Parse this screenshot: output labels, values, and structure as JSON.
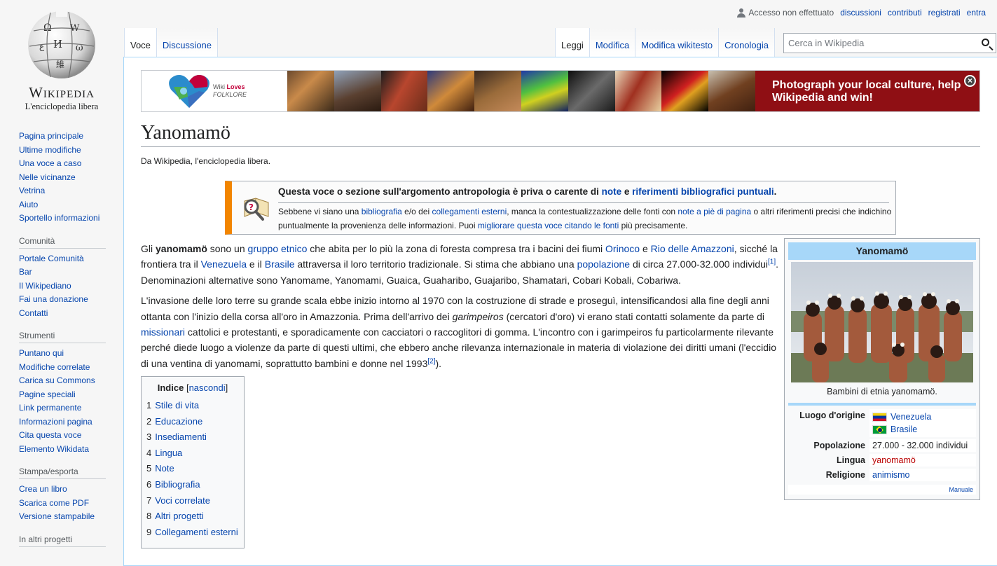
{
  "personal": {
    "status": "Accesso non effettuato",
    "links": [
      "discussioni",
      "contributi",
      "registrati",
      "entra"
    ]
  },
  "logo": {
    "wordmark": "Wikipedia",
    "tagline": "L'enciclopedia libera"
  },
  "sidebar": {
    "nav": [
      "Pagina principale",
      "Ultime modifiche",
      "Una voce a caso",
      "Nelle vicinanze",
      "Vetrina",
      "Aiuto",
      "Sportello informazioni"
    ],
    "comunita": {
      "heading": "Comunità",
      "items": [
        "Portale Comunità",
        "Bar",
        "Il Wikipediano",
        "Fai una donazione",
        "Contatti"
      ]
    },
    "strumenti": {
      "heading": "Strumenti",
      "items": [
        "Puntano qui",
        "Modifiche correlate",
        "Carica su Commons",
        "Pagine speciali",
        "Link permanente",
        "Informazioni pagina",
        "Cita questa voce",
        "Elemento Wikidata"
      ]
    },
    "stampa": {
      "heading": "Stampa/esporta",
      "items": [
        "Crea un libro",
        "Scarica come PDF",
        "Versione stampabile"
      ]
    },
    "altri": {
      "heading": "In altri progetti"
    }
  },
  "tabs": {
    "left": [
      "Voce",
      "Discussione"
    ],
    "right": [
      "Leggi",
      "Modifica",
      "Modifica wikitesto",
      "Cronologia"
    ]
  },
  "search": {
    "placeholder": "Cerca in Wikipedia"
  },
  "banner": {
    "logo_line1": "Wiki",
    "logo_line1b": "Loves",
    "logo_line2": "FOLKLORE",
    "cta": "Photograph your local culture, help Wikipedia and win!",
    "close": "×"
  },
  "article": {
    "title": "Yanomamö",
    "site_sub": "Da Wikipedia, l'enciclopedia libera.",
    "ambox": {
      "title_a": "Questa voce o sezione sull'argomento antropologia è priva o carente di ",
      "title_link1": "note",
      "title_b": " e ",
      "title_link2": "riferimenti bibliografici puntuali",
      "title_c": ".",
      "t_a": "Sebbene vi siano una ",
      "t_link1": "bibliografia",
      "t_b": " e/o dei ",
      "t_link2": "collegamenti esterni",
      "t_c": ", manca la contestualizzazione delle fonti con ",
      "t_link3": "note a piè di pagina",
      "t_d": " o altri riferimenti precisi che indichino puntualmente la provenienza delle informazioni. Puoi ",
      "t_link4": "migliorare questa voce",
      "t_e": " ",
      "t_link5": "citando le fonti",
      "t_f": " più precisamente."
    },
    "p1": {
      "a": "Gli ",
      "bold": "yanomamö",
      "b": " sono un ",
      "l1": "gruppo etnico",
      "c": " che abita per lo più la zona di foresta compresa tra i bacini dei fiumi ",
      "l2": "Orinoco",
      "d": " e ",
      "l3": "Rio delle Amazzoni",
      "e": ", sicché la frontiera tra il ",
      "l4": "Venezuela",
      "f": " e il ",
      "l5": "Brasile",
      "g": " attraversa il loro territorio tradizionale. Si stima che abbiano una ",
      "l6": "popolazione",
      "h": " di circa 27.000-32.000 individui",
      "ref": "[1]",
      "i": ". Denominazioni alternative sono Yanomame, Yanomami, Guaica, Guaharibo, Guajaribo, Shamatari, Cobari Kobali, Cobariwa."
    },
    "p2": {
      "a": "L'invasione delle loro terre su grande scala ebbe inizio intorno al 1970 con la costruzione di strade e proseguì, intensificandosi alla fine degli anni ottanta con l'inizio della corsa all'oro in Amazzonia. Prima dell'arrivo dei ",
      "ital": "garimpeiros",
      "b": " (cercatori d'oro) vi erano stati contatti solamente da parte di ",
      "l1": "missionari",
      "c": " cattolici e protestanti, e sporadicamente con cacciatori o raccoglitori di gomma. L'incontro con i garimpeiros fu particolarmente rilevante perché diede luogo a violenze da parte di questi ultimi, che ebbero anche rilevanza internazionale in materia di violazione dei diritti umani (l'eccidio di una ventina di yanomami, soprattutto bambini e donne nel 1993",
      "ref": "[2]",
      "d": ")."
    }
  },
  "toc": {
    "title": "Indice",
    "toggle_open": "[",
    "toggle": "nascondi",
    "toggle_close": "]",
    "items": [
      {
        "num": "1",
        "label": "Stile di vita"
      },
      {
        "num": "2",
        "label": "Educazione"
      },
      {
        "num": "3",
        "label": "Insediamenti"
      },
      {
        "num": "4",
        "label": "Lingua"
      },
      {
        "num": "5",
        "label": "Note"
      },
      {
        "num": "6",
        "label": "Bibliografia"
      },
      {
        "num": "7",
        "label": "Voci correlate"
      },
      {
        "num": "8",
        "label": "Altri progetti"
      },
      {
        "num": "9",
        "label": "Collegamenti esterni"
      }
    ]
  },
  "infobox": {
    "title": "Yanomamö",
    "caption": "Bambini di etnia yanomamö.",
    "rows": {
      "origine_label": "Luogo d'origine",
      "origine_values": [
        "Venezuela",
        "Brasile"
      ],
      "popolazione_label": "Popolazione",
      "popolazione_value": "27.000 - 32.000 individui",
      "lingua_label": "Lingua",
      "lingua_value": "yanomamö",
      "religione_label": "Religione",
      "religione_value": "animismo"
    },
    "manual": "Manuale"
  },
  "colors": {
    "link": "#0645ad",
    "redlink": "#ba0000",
    "ambox_stripe": "#f28500",
    "infobox_header": "#a7d7f9",
    "banner_cta": "#8f0f14"
  }
}
